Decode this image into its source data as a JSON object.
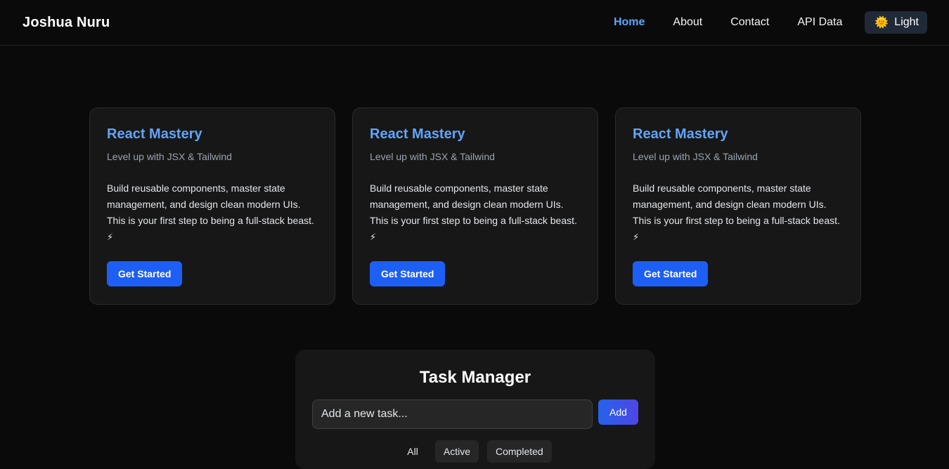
{
  "navbar": {
    "brand": "Joshua Nuru",
    "links": [
      {
        "label": "Home",
        "active": true
      },
      {
        "label": "About",
        "active": false
      },
      {
        "label": "Contact",
        "active": false
      },
      {
        "label": "API Data",
        "active": false
      }
    ],
    "theme_toggle": {
      "icon": "sun-icon",
      "glyph": "🌞",
      "label": "Light"
    }
  },
  "cards": [
    {
      "title": "React Mastery",
      "subtitle": "Level up with JSX & Tailwind",
      "body": "Build reusable components, master state management, and design clean modern UIs. This is your first step to being a full-stack beast.",
      "emoji": "⚡",
      "button": "Get Started"
    },
    {
      "title": "React Mastery",
      "subtitle": "Level up with JSX & Tailwind",
      "body": "Build reusable components, master state management, and design clean modern UIs. This is your first step to being a full-stack beast.",
      "emoji": "⚡",
      "button": "Get Started"
    },
    {
      "title": "React Mastery",
      "subtitle": "Level up with JSX & Tailwind",
      "body": "Build reusable components, master state management, and design clean modern UIs. This is your first step to being a full-stack beast.",
      "emoji": "⚡",
      "button": "Get Started"
    }
  ],
  "task_manager": {
    "title": "Task Manager",
    "input_placeholder": "Add a new task...",
    "input_value": "",
    "add_label": "Add",
    "filters": [
      "All",
      "Active",
      "Completed"
    ]
  },
  "colors": {
    "background": "#0a0a0a",
    "accent": "#60a5fa",
    "button": "#1d5ff5",
    "card": "#171717"
  }
}
